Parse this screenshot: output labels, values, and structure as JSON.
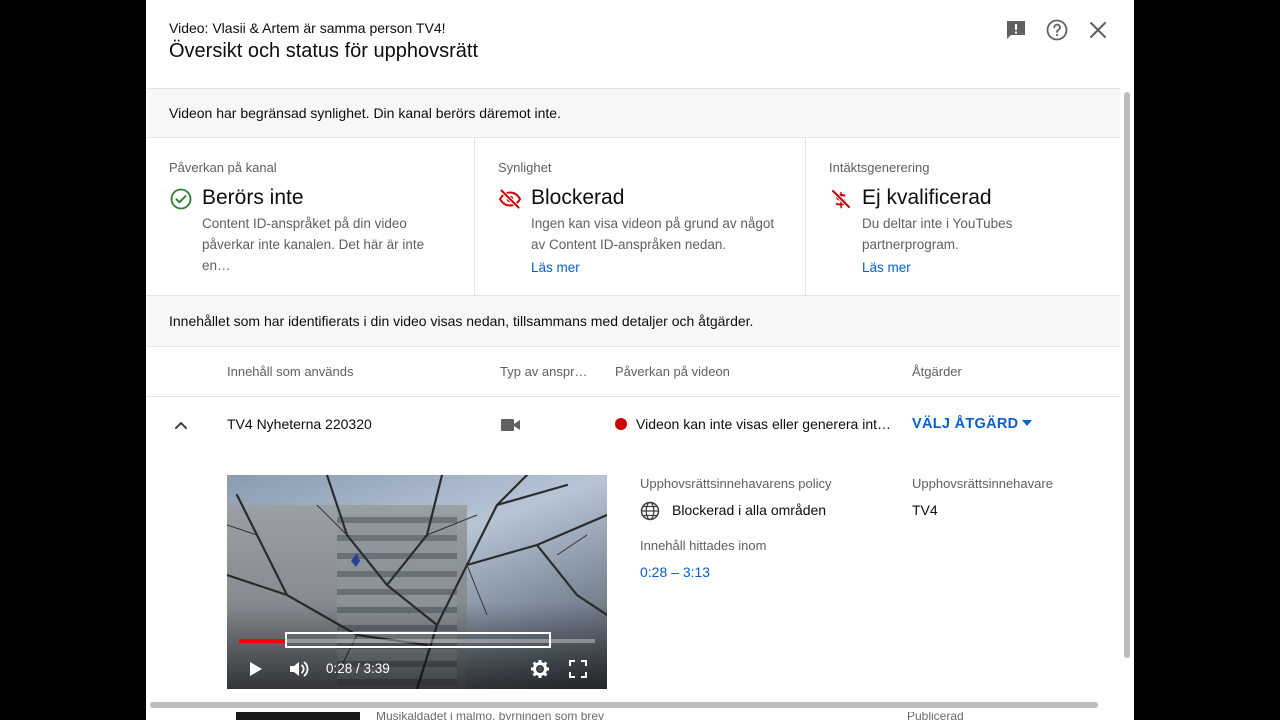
{
  "background": {
    "row_title": "Musikaldadet i malmo, byrningen som brev",
    "row_status": "Publicerad"
  },
  "dialog": {
    "subtitle": "Video: Vlasii & Artem är samma person TV4!",
    "title": "Översikt och status för upphovsrätt",
    "banner": "Videon har begränsad synlighet. Din kanal berörs däremot inte.",
    "cards": [
      {
        "label": "Påverkan på kanal",
        "icon": "check-circle-icon",
        "headline": "Berörs inte",
        "description": "Content ID-anspråket på din video påverkar inte kanalen. Det här är inte en…",
        "link": ""
      },
      {
        "label": "Synlighet",
        "icon": "eye-off-icon",
        "headline": "Blockerad",
        "description": "Ingen kan visa videon på grund av något av Content ID-anspråken nedan.",
        "link": "Läs mer"
      },
      {
        "label": "Intäktsgenerering",
        "icon": "dollar-off-icon",
        "headline": "Ej kvalificerad",
        "description": "Du deltar inte i YouTubes partnerprogram.",
        "link": "Läs mer"
      }
    ],
    "info": "Innehållet som har identifierats i din video visas nedan, tillsammans med detaljer och åtgärder.",
    "table": {
      "headers": [
        "Innehåll som används",
        "Typ av anspr…",
        "Påverkan på videon",
        "Åtgärder"
      ],
      "row": {
        "content": "TV4 Nyheterna 220320",
        "type_icon": "videocam-icon",
        "impact": "Videon kan inte visas eller generera int…",
        "action": "VÄLJ ÅTGÄRD"
      }
    },
    "details": {
      "policy_label": "Upphovsrättsinnehavarens policy",
      "policy_value": "Blockerad i alla områden",
      "found_label": "Innehåll hittades inom",
      "found_range": "0:28 – 3:13",
      "owner_label": "Upphovsrättsinnehavare",
      "owner_value": "TV4"
    },
    "player": {
      "time": "0:28 / 3:39",
      "progress": 0.128,
      "match_start": 0.128,
      "match_end": 0.877
    }
  },
  "colors": {
    "accent": "#065fd4",
    "success": "#2e7d32",
    "danger": "#cc0000",
    "banner_bg": "#f7f7f7"
  }
}
